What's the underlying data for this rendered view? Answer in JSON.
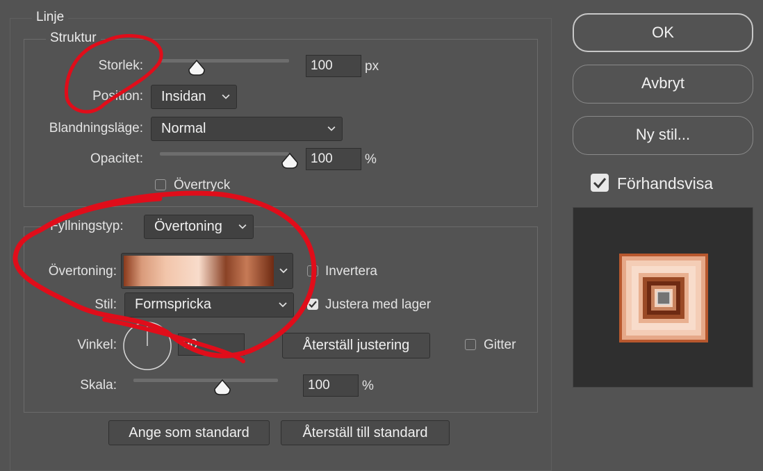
{
  "panel": {
    "title": "Linje"
  },
  "structure": {
    "legend": "Struktur",
    "size_label": "Storlek:",
    "size_value": "100",
    "size_unit": "px",
    "size_slider_fraction": 0.28,
    "position_label": "Position:",
    "position_value": "Insidan",
    "blend_label": "Blandningsläge:",
    "blend_value": "Normal",
    "opacity_label": "Opacitet:",
    "opacity_value": "100",
    "opacity_unit": "%",
    "opacity_slider_fraction": 1.0,
    "overprint_label": "Övertryck",
    "overprint_checked": false
  },
  "fill": {
    "type_label": "Fyllningstyp:",
    "type_value": "Övertoning",
    "gradient_label": "Övertoning:",
    "invert_label": "Invertera",
    "invert_checked": false,
    "style_label": "Stil:",
    "style_value": "Formspricka",
    "align_label": "Justera med lager",
    "align_checked": true,
    "angle_label": "Vinkel:",
    "angle_value": "90",
    "reset_align_label": "Återställ justering",
    "dither_label": "Gitter",
    "dither_checked": false,
    "scale_label": "Skala:",
    "scale_value": "100",
    "scale_unit": "%",
    "scale_slider_fraction": 0.61
  },
  "footer": {
    "default_label": "Ange som standard",
    "reset_default_label": "Återställ till standard"
  },
  "side": {
    "ok_label": "OK",
    "cancel_label": "Avbryt",
    "new_style_label": "Ny stil...",
    "preview_label": "Förhandsvisa",
    "preview_checked": true
  },
  "colors": {
    "annotation": "#e00d1a",
    "gradient": [
      "#8a3a1c",
      "#f2c5aa",
      "#f8dccb",
      "#8a4226",
      "#c67a56",
      "#6e2a12"
    ]
  }
}
